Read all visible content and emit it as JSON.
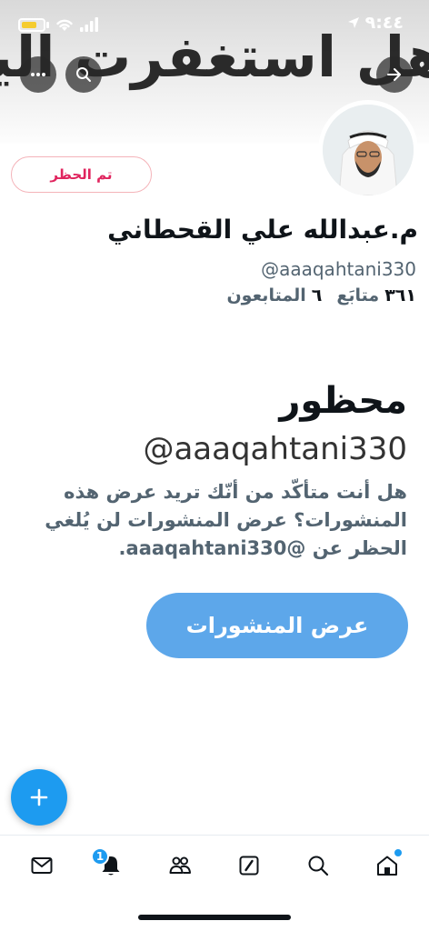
{
  "status_bar": {
    "time": "٩:٤٤"
  },
  "banner": {
    "text": "هل استغفرت اليوم؟"
  },
  "profile": {
    "blocked_button_label": "تم الحظر",
    "name": "م.عبدالله علي القحطاني",
    "handle": "@aaaqahtani330",
    "following_count": "٣٦١",
    "following_label": "متابَع",
    "followers_count": "٦",
    "followers_label": "المتابعون"
  },
  "blocked_notice": {
    "title": "محظور",
    "handle": "@aaaqahtani330",
    "message": "هل أنت متأكّد من أنّك تريد عرض هذه المنشورات؟ عرض المنشورات لن يُلغي الحظر عن @aaaqahtani330.",
    "view_button_label": "عرض المنشورات"
  },
  "tab_bar": {
    "tabs": [
      "messages-icon",
      "notifications-icon",
      "communities-icon",
      "grok-icon",
      "search-icon",
      "home-icon"
    ],
    "notifications_badge": "1"
  },
  "colors": {
    "accent": "#1d9bf0",
    "blocked_red": "#e0245e",
    "view_button": "#5da7ea"
  }
}
